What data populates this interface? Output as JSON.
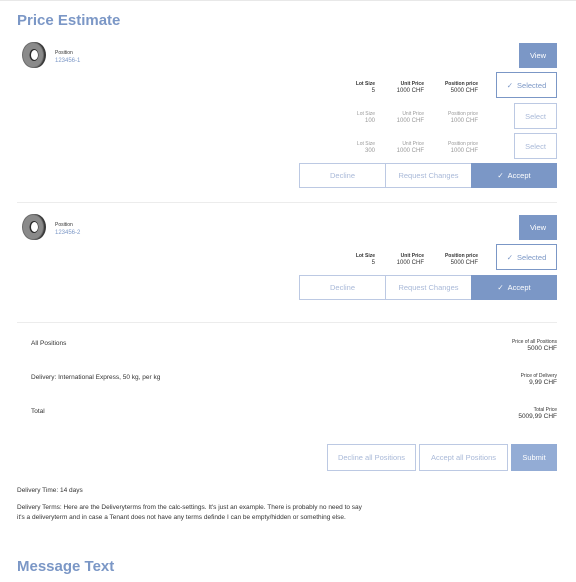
{
  "titles": {
    "price_estimate": "Price Estimate",
    "message_text": "Message Text"
  },
  "positions": [
    {
      "label": "Position",
      "id": "123456-1",
      "view_label": "View",
      "rows": [
        {
          "lot_size_label": "Lot Size",
          "lot_size": "5",
          "unit_price_label": "Unit Price",
          "unit_price": "1000 CHF",
          "position_price_label": "Position price",
          "position_price": "5000 CHF",
          "button_label": "Selected",
          "state": "selected"
        },
        {
          "lot_size_label": "Lot Size",
          "lot_size": "100",
          "unit_price_label": "Unit Price",
          "unit_price": "1000 CHF",
          "position_price_label": "Position price",
          "position_price": "1000 CHF",
          "button_label": "Select",
          "state": "unselected"
        },
        {
          "lot_size_label": "Lot Size",
          "lot_size": "300",
          "unit_price_label": "Unit Price",
          "unit_price": "1000 CHF",
          "position_price_label": "Position price",
          "position_price": "1000 CHF",
          "button_label": "Select",
          "state": "unselected"
        }
      ],
      "decline_label": "Decline",
      "request_changes_label": "Request Changes",
      "accept_label": "Accept"
    },
    {
      "label": "Position",
      "id": "123456-2",
      "view_label": "View",
      "rows": [
        {
          "lot_size_label": "Lot Size",
          "lot_size": "5",
          "unit_price_label": "Unit Price",
          "unit_price": "1000 CHF",
          "position_price_label": "Position price",
          "position_price": "5000 CHF",
          "button_label": "Selected",
          "state": "selected"
        }
      ],
      "decline_label": "Decline",
      "request_changes_label": "Request Changes",
      "accept_label": "Accept"
    }
  ],
  "summary": {
    "all_positions_label": "All Positions",
    "all_positions_price_label": "Price of all Positions",
    "all_positions_price": "5000 CHF",
    "delivery_label": "Delivery: International Express, 50 kg, per kg",
    "delivery_price_label": "Price of Delivery",
    "delivery_price": "9,99 CHF",
    "total_label": "Total",
    "total_price_label": "Total Price",
    "total_price": "5009,99 CHF"
  },
  "actions": {
    "decline_all": "Decline all Positions",
    "accept_all": "Accept all Positions",
    "submit": "Submit"
  },
  "delivery_time": "Delivery Time: 14 days",
  "delivery_terms": "Delivery Terms: Here are the Deliveryterms from the calc-settings. It's just an example. There is probably no need to say it's a deliveryterm and in case a Tenant does not have any terms definde I can be empty/hidden or something else.",
  "colors": {
    "accent": "#7b97c6",
    "border_muted": "#bcc9e3",
    "separator": "#ececec"
  },
  "icons": {
    "product": "ring-icon",
    "check": "check-icon"
  }
}
